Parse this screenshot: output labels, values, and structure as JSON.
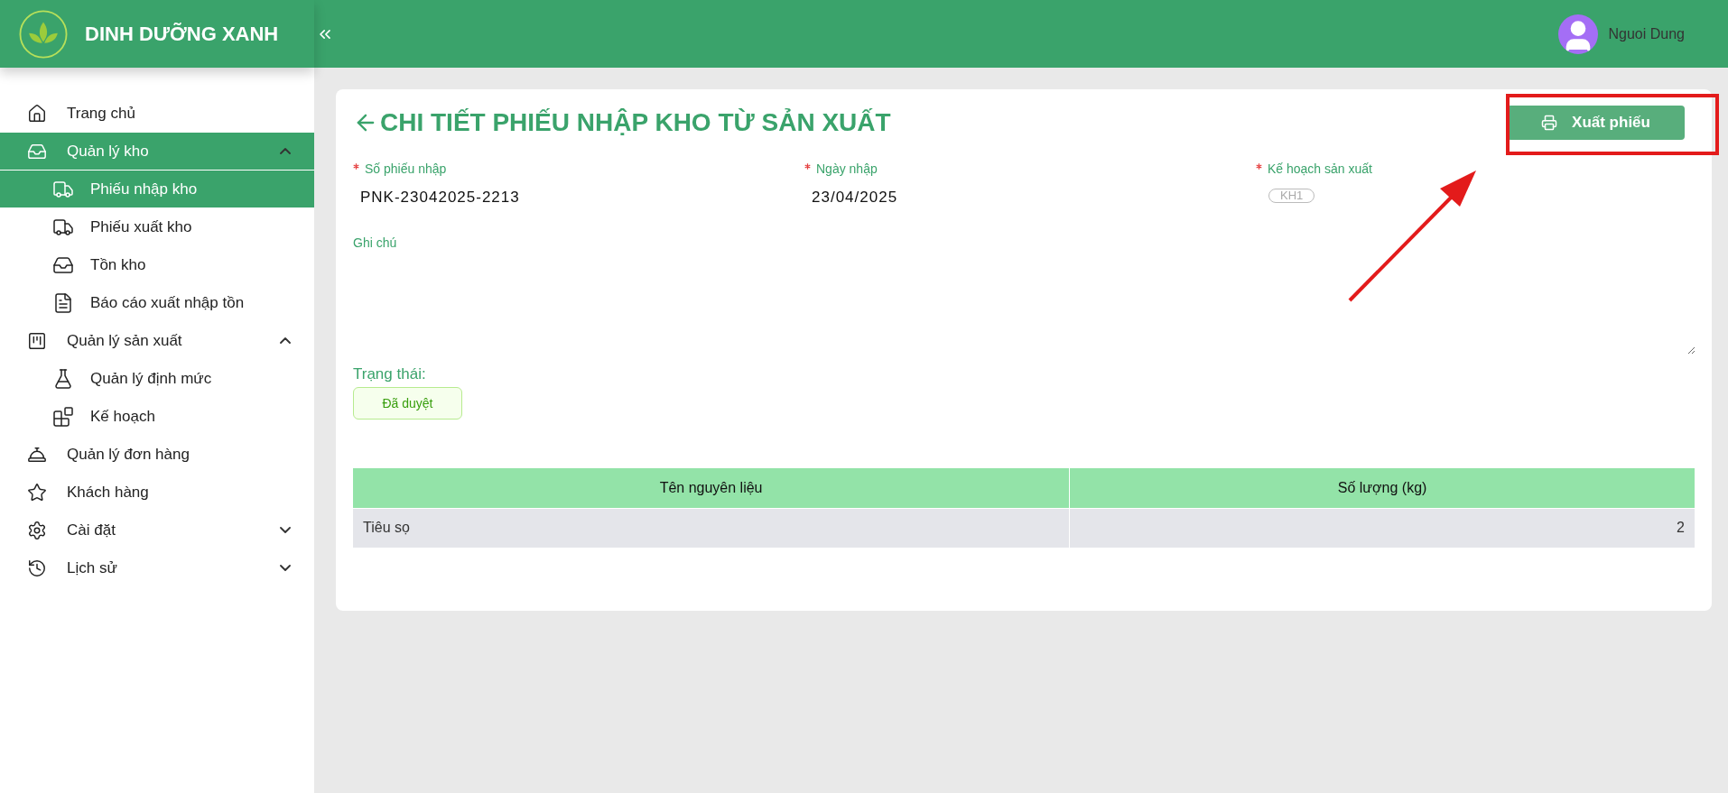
{
  "brand": {
    "name": "DINH DƯỠNG XANH"
  },
  "header": {
    "user_name": "Nguoi Dung"
  },
  "sidebar": {
    "items": [
      {
        "label": "Trang chủ",
        "selected": false
      },
      {
        "label": "Quản lý kho",
        "selected": true,
        "expanded": true,
        "children": [
          {
            "label": "Phiếu nhập kho",
            "selected": true
          },
          {
            "label": "Phiếu xuất kho",
            "selected": false
          },
          {
            "label": "Tồn kho",
            "selected": false
          },
          {
            "label": "Báo cáo xuất nhập tồn",
            "selected": false
          }
        ]
      },
      {
        "label": "Quản lý sản xuất",
        "selected": false,
        "expanded": true,
        "children": [
          {
            "label": "Quản lý định mức",
            "selected": false
          },
          {
            "label": "Kế hoạch",
            "selected": false
          }
        ]
      },
      {
        "label": "Quản lý đơn hàng",
        "selected": false
      },
      {
        "label": "Khách hàng",
        "selected": false
      },
      {
        "label": "Cài đặt",
        "selected": false,
        "expanded": false
      },
      {
        "label": "Lịch sử",
        "selected": false,
        "expanded": false
      }
    ]
  },
  "page": {
    "title": "CHI TIẾT PHIẾU NHẬP KHO TỪ SẢN XUẤT",
    "export_button": "Xuất phiếu",
    "fields": [
      {
        "kind": "text",
        "label": "Số phiếu nhập",
        "required": true,
        "value": "PNK-23042025-2213"
      },
      {
        "kind": "text",
        "label": "Ngày nhập",
        "required": true,
        "value": "23/04/2025"
      },
      {
        "kind": "tags",
        "label": "Kế hoạch sản xuất",
        "required": true,
        "tags": [
          "KH1"
        ]
      }
    ],
    "note": {
      "label": "Ghi chú"
    },
    "status": {
      "label": "Trạng thái:",
      "value": "Đã duyệt"
    },
    "table": {
      "columns": [
        "Tên nguyên liệu",
        "Số lượng (kg)"
      ],
      "rows": [
        [
          "Tiêu sọ",
          "2"
        ]
      ]
    }
  }
}
